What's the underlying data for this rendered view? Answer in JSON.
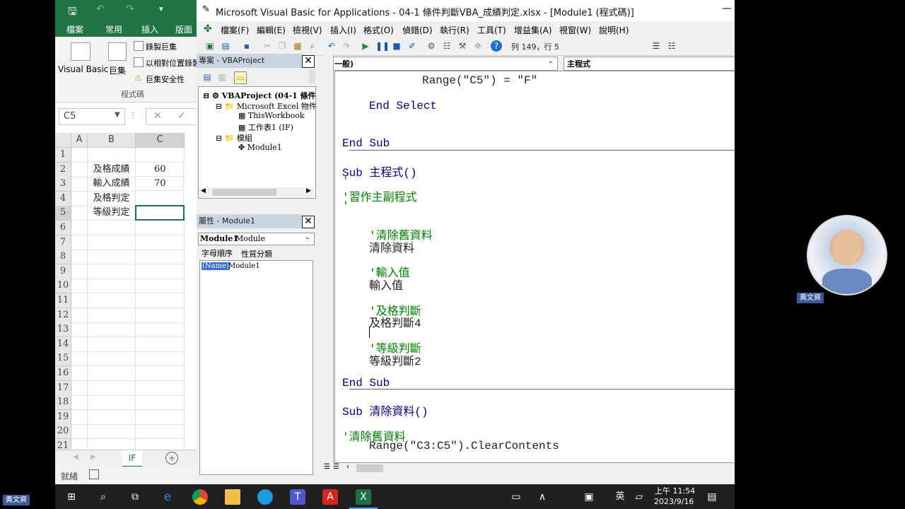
{
  "excel": {
    "ribbon_tabs": [
      "檔案",
      "常用",
      "插入",
      "版面配"
    ],
    "ribbon_buttons": {
      "visual_basic": "Visual Basic",
      "macros": "巨集",
      "record_macro": "錄製巨集",
      "relative_ref": "以相對位置錄製",
      "macro_security": "巨集安全性",
      "group_label": "程式碼"
    },
    "name_box": "C5",
    "columns": [
      "A",
      "B",
      "C"
    ],
    "rows": [
      "1",
      "2",
      "3",
      "4",
      "5",
      "6",
      "7",
      "8",
      "9",
      "10",
      "11",
      "12",
      "13",
      "14",
      "15",
      "16",
      "17",
      "18",
      "19",
      "20",
      "21"
    ],
    "cells": [
      {
        "label": "及格成績",
        "value": "60"
      },
      {
        "label": "輸入成績",
        "value": "70"
      },
      {
        "label": "及格判定",
        "value": ""
      },
      {
        "label": "等級判定",
        "value": ""
      }
    ],
    "sheet_tab": "IF",
    "status": "就緒"
  },
  "vba": {
    "title": "Microsoft Visual Basic for Applications - 04-1 條件判斷VBA_成績判定.xlsx - [Module1 (程式碼)]",
    "menu": [
      "檔案(F)",
      "編輯(E)",
      "檢視(V)",
      "插入(I)",
      "格式(O)",
      "偵錯(D)",
      "執行(R)",
      "工具(T)",
      "增益集(A)",
      "視窗(W)",
      "說明(H)"
    ],
    "cursor_pos": "列 149，行 5",
    "project_title": "專案 - VBAProject",
    "tree": {
      "root": "VBAProject (04-1 條件",
      "excel_objects": "Microsoft Excel 物件",
      "this_workbook": "ThisWorkbook",
      "sheet1": "工作表1 (IF)",
      "modules": "模組",
      "module1": "Module1"
    },
    "props_title": "屬性 - Module1",
    "props_object": "Module1",
    "props_object_type": "Module",
    "props_tabs": [
      "字母順序",
      "性質分類"
    ],
    "props_row": {
      "name": "(Name)",
      "value": "Module1"
    },
    "object_combo": "(一般)",
    "proc_combo": "主程式",
    "code": {
      "l1": "Range(\"C5\") = \"F\"",
      "l2": "End Select",
      "l3": "End Sub",
      "l4": "Sub 主程式()",
      "l5": "'",
      "l6": "'習作主副程式",
      "l7": "'",
      "l8": "'清除舊資料",
      "l9": "清除資料",
      "l10": "'輸入值",
      "l11": "輸入值",
      "l12": "'及格判斷",
      "l13": "及格判斷4",
      "l14": "'等級判斷",
      "l15": "等級判斷2",
      "l16": "End Sub",
      "l17": "Sub 清除資料()",
      "l18": "'清除舊資料",
      "l19": "Range(\"C3:C5\").ClearContents"
    }
  },
  "presenter": {
    "name": "黃文資"
  },
  "bottom_label": "黃文資",
  "taskbar": {
    "ime": "英",
    "time": "上午 11:54",
    "date": "2023/9/16"
  }
}
